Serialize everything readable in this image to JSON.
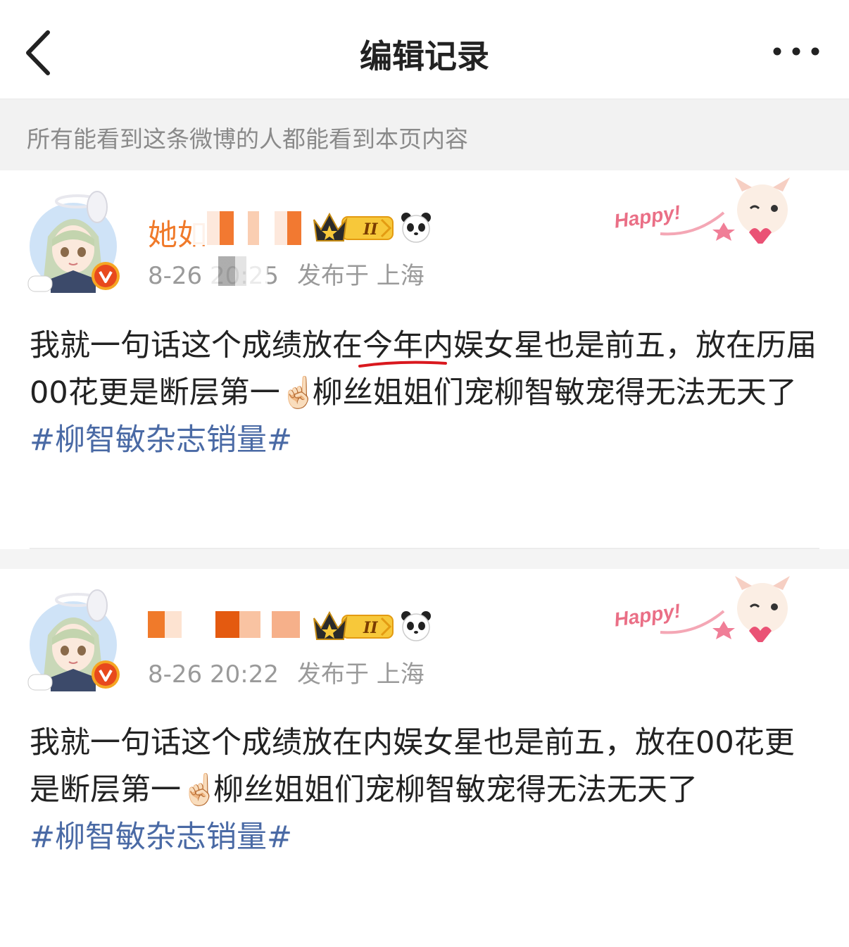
{
  "header": {
    "title": "编辑记录",
    "back_icon": "chevron-left-icon",
    "more_icon": "ellipsis-icon"
  },
  "notice": "所有能看到这条微博的人都能看到本页内容",
  "posts": [
    {
      "username_visible": "她如",
      "time": "8-26 20:25",
      "location": "发布于 上海",
      "badges": [
        "crown-badge-II",
        "panda-icon"
      ],
      "decoration": "Happy!",
      "text_parts": [
        "我就一句话这个成绩放在",
        "今年",
        "内娱女星也是前五，放在历届00花更是断层第一",
        "☝🏻",
        "柳丝姐姐们宠柳智敏宠得无法无天了"
      ],
      "hashtag": "#柳智敏杂志销量#"
    },
    {
      "username_visible": "",
      "time": "8-26 20:22",
      "location": "发布于 上海",
      "badges": [
        "crown-badge-II",
        "panda-icon"
      ],
      "decoration": "Happy!",
      "text_parts": [
        "我就一句话这个成绩放在内娱女星也是前五，放在00花更是断层第一",
        "☝🏻",
        "柳丝姐姐们宠柳智敏宠得无法无天了"
      ],
      "hashtag": "#柳智敏杂志销量#"
    }
  ],
  "colors": {
    "username": "#f07a2a",
    "hashtag": "#4a6aa5",
    "meta": "#9a9a9a",
    "underline": "#d9181e",
    "verified": "#e8491d"
  }
}
